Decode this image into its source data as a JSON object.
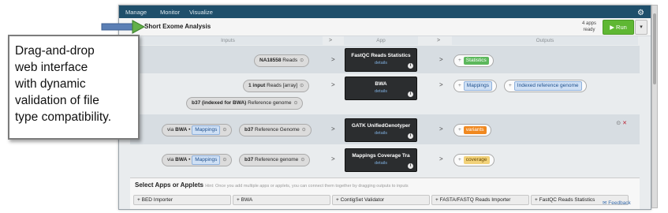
{
  "nav": {
    "items": [
      "Manage",
      "Monitor",
      "Visualize"
    ]
  },
  "workflow": {
    "title": "Short Exome Analysis",
    "apps_count": "4 apps",
    "apps_status": "ready",
    "run_label": "Run",
    "columns": {
      "inputs": "Inputs",
      "app": "App",
      "outputs": "Outputs"
    }
  },
  "rows": [
    {
      "inputs": [
        {
          "bold": "NA18558",
          "label": "Reads"
        }
      ],
      "app": {
        "name": "FastQC Reads Statistics",
        "sub": "details"
      },
      "outputs": [
        {
          "tag": "Statistics",
          "color": "green"
        }
      ]
    },
    {
      "inputs": [
        {
          "bold": "1 input",
          "label": "Reads [array]"
        },
        {
          "bold": "b37 (indexed for BWA)",
          "label": "Reference genome"
        }
      ],
      "app": {
        "name": "BWA",
        "sub": "details"
      },
      "outputs": [
        {
          "tag": "Mappings",
          "color": "blue"
        },
        {
          "tag": "Indexed reference genome",
          "color": "blue"
        }
      ]
    },
    {
      "inputs": [
        {
          "prefix": "via",
          "bold": "BWA",
          "tag": "Mappings"
        },
        {
          "bold": "b37",
          "label": "Reference Genome"
        }
      ],
      "app": {
        "name": "GATK UnifiedGenotyper",
        "sub": "details"
      },
      "outputs": [
        {
          "tag": "variants",
          "color": "orange"
        }
      ]
    },
    {
      "inputs": [
        {
          "prefix": "via",
          "bold": "BWA",
          "tag": "Mappings"
        },
        {
          "bold": "b37",
          "label": "Reference genome"
        }
      ],
      "app": {
        "name": "Mappings Coverage Tra",
        "sub": "details"
      },
      "outputs": [
        {
          "tag": "coverage",
          "color": "yellow"
        }
      ]
    }
  ],
  "select_apps": {
    "title": "Select Apps or Applets",
    "hint": "Hint: Once you add multiple apps or applets, you can connect them together by dragging outputs to inputs",
    "buttons": [
      "BED Importer",
      "BWA",
      "ContigSet Validator",
      "FASTA/FASTQ Reads Importer",
      "FastQC Reads Statistics"
    ]
  },
  "feedback": "Feedback",
  "callout": {
    "text": "Drag-and-drop\nweb interface\nwith dynamic\nvalidation of file\ntype compatibility."
  },
  "colors": {
    "green": "#5cb85c",
    "orange": "#f0881f",
    "yellow": "#f2d27a",
    "blue": "#cfe0f5",
    "nav": "#1f4f6b",
    "run": "#5fb733"
  },
  "icons": {
    "settings": "gear-icon",
    "remove": "close-icon",
    "info": "info-icon",
    "add": "plus-icon",
    "pointer": "arrow-pointer"
  }
}
